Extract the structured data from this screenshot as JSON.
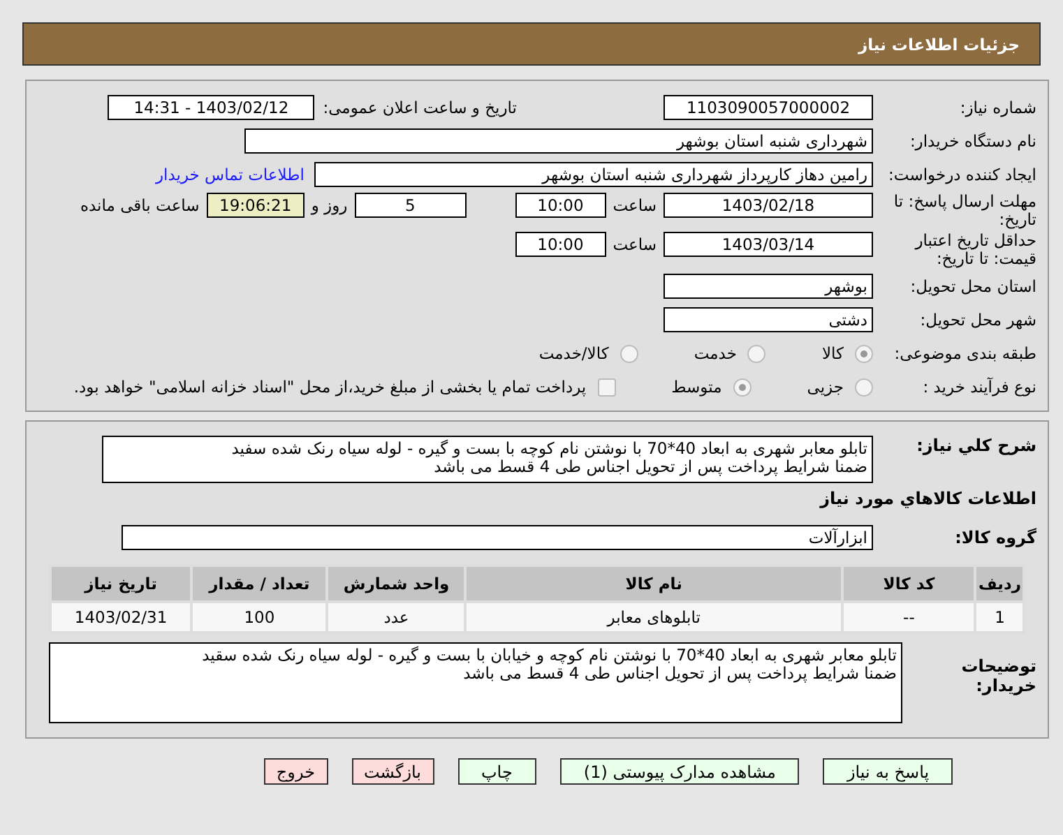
{
  "page_title": "جزئیات اطلاعات نیاز",
  "need_number": {
    "label": "شماره نیاز:",
    "value": "1103090057000002"
  },
  "announce": {
    "label": "تاریخ و ساعت اعلان عمومی:",
    "value": "1403/02/12 - 14:31"
  },
  "buyer_org": {
    "label": "نام دستگاه خریدار:",
    "value": "شهرداری شنبه استان بوشهر"
  },
  "requester": {
    "label": "ایجاد کننده درخواست:",
    "value": "رامین دهاز کارپرداز شهرداری شنبه استان بوشهر",
    "link": "اطلاعات تماس خریدار"
  },
  "reply_deadline": {
    "label": "مهلت ارسال پاسخ: تا تاریخ:",
    "date": "1403/02/18",
    "time_label": "ساعت",
    "time": "10:00",
    "days": "5",
    "days_label": "روز و",
    "remaining": "19:06:21",
    "remaining_label": "ساعت باقی مانده"
  },
  "price_validity": {
    "label": "حداقل تاریخ اعتبار قیمت: تا تاریخ:",
    "date": "1403/03/14",
    "time_label": "ساعت",
    "time": "10:00"
  },
  "province": {
    "label": "استان محل تحویل:",
    "value": "بوشهر"
  },
  "city": {
    "label": "شهر محل تحویل:",
    "value": "دشتی"
  },
  "category": {
    "label": "طبقه بندی موضوعی:",
    "options": [
      {
        "label": "کالا",
        "selected": true
      },
      {
        "label": "خدمت",
        "selected": false
      },
      {
        "label": "کالا/خدمت",
        "selected": false
      }
    ]
  },
  "purchase_type": {
    "label": "نوع فرآیند خرید :",
    "options": [
      {
        "label": "جزیی",
        "selected": false
      },
      {
        "label": "متوسط",
        "selected": true
      }
    ],
    "payment_note": {
      "checked": false,
      "text": "پرداخت تمام یا بخشی از مبلغ خرید،از محل \"اسناد خزانه اسلامی\" خواهد بود."
    }
  },
  "description": {
    "label": "شرح کلي نياز:",
    "text": "تابلو معابر شهری به ابعاد 40*70 با نوشتن نام کوچه با بست و گیره - لوله سیاه رنک شده سفید\nضمنا شرایط پرداخت پس از تحویل اجناس طی 4 قسط  می باشد"
  },
  "goods_heading": "اطلاعات کالاهاي مورد نياز",
  "goods_group": {
    "label": "گروه کالا:",
    "value": "ابزارآلات"
  },
  "table": {
    "columns": [
      "ردیف",
      "کد کالا",
      "نام کالا",
      "واحد شمارش",
      "تعداد / مقدار",
      "تاریخ نیاز"
    ],
    "rows": [
      [
        "1",
        "--",
        "تابلوهای معابر",
        "عدد",
        "100",
        "1403/02/31"
      ]
    ]
  },
  "buyer_notes": {
    "label": "توضیحات خریدار:",
    "text": "تابلو معابر شهری به ابعاد 40*70 با نوشتن نام کوچه و خیابان با بست و گیره - لوله سیاه رنک شده سقید\nضمنا شرایط پرداخت پس از تحویل اجناس طی 4 قسط می باشد"
  },
  "buttons": [
    {
      "label": "پاسخ به نیاز",
      "kind": "action"
    },
    {
      "label": "مشاهده مدارک پیوستی (1)",
      "kind": "action"
    },
    {
      "label": "چاپ",
      "kind": "action"
    },
    {
      "label": "بازگشت",
      "kind": "exit"
    },
    {
      "label": "خروج",
      "kind": "exit"
    }
  ]
}
